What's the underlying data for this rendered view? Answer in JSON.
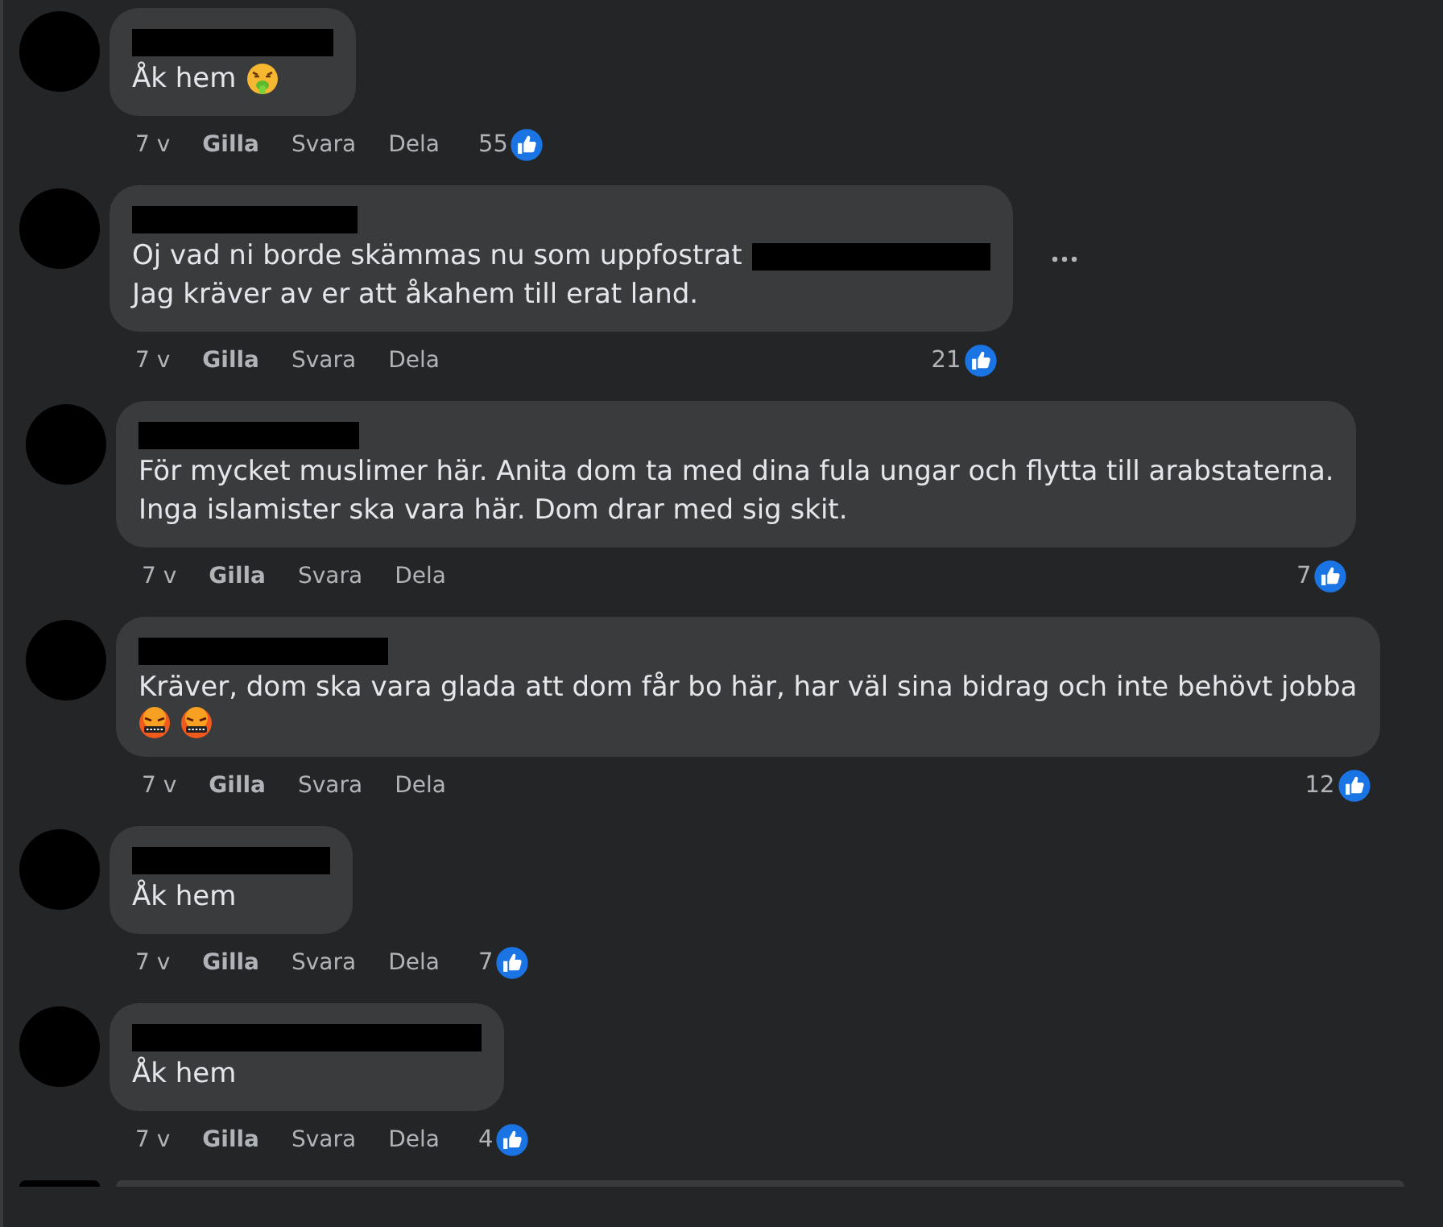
{
  "comments": [
    {
      "kind": "comment",
      "more_button": false,
      "lines": [
        [
          {
            "kind": "text",
            "text": "Åk hem"
          },
          {
            "kind": "nauseated"
          }
        ]
      ],
      "actions": {
        "time": "7 v",
        "like": "Gilla",
        "reply": "Svara",
        "share": "Dela"
      },
      "likes": "55"
    },
    {
      "kind": "comment",
      "more_button": true,
      "lines": [
        [
          {
            "kind": "text",
            "text": "Oj vad ni borde skämmas nu som uppfostrat"
          },
          {
            "kind": "redaction"
          }
        ],
        [
          {
            "kind": "text",
            "text": "Jag kräver av er att åkahem till erat land."
          }
        ]
      ],
      "actions": {
        "time": "7 v",
        "like": "Gilla",
        "reply": "Svara",
        "share": "Dela"
      },
      "likes": "21"
    },
    {
      "kind": "comment",
      "more_button": false,
      "lines": [
        [
          {
            "kind": "text",
            "text": "För mycket muslimer här. Anita dom ta med dina fula ungar och flytta till arabstaterna."
          }
        ],
        [
          {
            "kind": "text",
            "text": "Inga islamister ska vara här. Dom drar med sig skit."
          }
        ]
      ],
      "actions": {
        "time": "7 v",
        "like": "Gilla",
        "reply": "Svara",
        "share": "Dela"
      },
      "likes": "7"
    },
    {
      "kind": "comment",
      "more_button": false,
      "lines": [
        [
          {
            "kind": "text",
            "text": "Kräver, dom ska vara glada att dom får bo här, har väl sina bidrag och inte behövt jobba"
          }
        ],
        [
          {
            "kind": "cursing"
          },
          {
            "kind": "cursing"
          }
        ]
      ],
      "actions": {
        "time": "7 v",
        "like": "Gilla",
        "reply": "Svara",
        "share": "Dela"
      },
      "likes": "12"
    },
    {
      "kind": "comment",
      "more_button": false,
      "lines": [
        [
          {
            "kind": "text",
            "text": "Åk hem"
          }
        ]
      ],
      "actions": {
        "time": "7 v",
        "like": "Gilla",
        "reply": "Svara",
        "share": "Dela"
      },
      "likes": "7"
    },
    {
      "kind": "comment",
      "more_button": false,
      "lines": [
        [
          {
            "kind": "text",
            "text": "Åk hem"
          }
        ]
      ],
      "actions": {
        "time": "7 v",
        "like": "Gilla",
        "reply": "Svara",
        "share": "Dela"
      },
      "likes": "4"
    },
    {
      "kind": "cut_off"
    }
  ]
}
